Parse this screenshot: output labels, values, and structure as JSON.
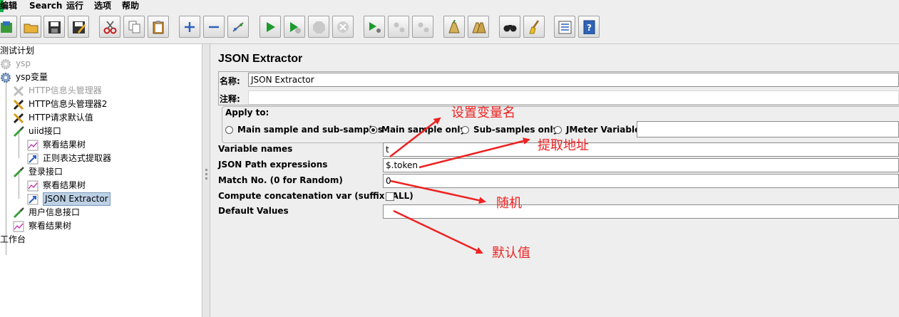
{
  "menu": [
    "编辑",
    "Search",
    "运行",
    "选项",
    "帮助"
  ],
  "toolbar": {
    "icons": [
      "open-templates-icon",
      "open-folder-icon",
      "save-icon",
      "save-as-icon",
      "cut-icon",
      "copy-icon",
      "paste-icon",
      "expand-icon",
      "collapse-icon",
      "toggle-icon",
      "start-icon",
      "start-no-pause-icon",
      "stop-icon",
      "shutdown-icon",
      "remote-start-icon",
      "remote-stop-icon",
      "remote-shutdown-icon",
      "clear-icon",
      "clear-all-icon",
      "search-icon",
      "reset-search-icon",
      "function-helper-icon",
      "help-icon"
    ]
  },
  "tree": [
    {
      "label": "测试计划",
      "icon": "none"
    },
    {
      "label": "ysp",
      "icon": "gear-icon",
      "disabled": true
    },
    {
      "label": "ysp变量",
      "icon": "gear-icon"
    },
    {
      "label": "HTTP信息头管理器",
      "icon": "wrench-icon",
      "disabled": true
    },
    {
      "label": "HTTP信息头管理器2",
      "icon": "wrench-icon"
    },
    {
      "label": "HTTP请求默认值",
      "icon": "wrench-icon"
    },
    {
      "label": "uiid接口",
      "icon": "pipette-icon"
    },
    {
      "label": "察看结果树",
      "icon": "graph-icon"
    },
    {
      "label": "正则表达式提取器",
      "icon": "extractor-icon"
    },
    {
      "label": "登录接口",
      "icon": "pipette-icon"
    },
    {
      "label": "察看结果树",
      "icon": "graph-icon"
    },
    {
      "label": "JSON Extractor",
      "icon": "extractor-icon",
      "selected": true
    },
    {
      "label": "用户信息接口",
      "icon": "pipette-icon"
    },
    {
      "label": "察看结果树",
      "icon": "graph-icon"
    },
    {
      "label": "工作台",
      "icon": "none"
    }
  ],
  "panel": {
    "title": "JSON Extractor",
    "name_label": "名称:",
    "name_value": "JSON Extractor",
    "comment_label": "注释:",
    "comment_value": "",
    "apply_to_label": "Apply to:",
    "apply_options": [
      {
        "label": "Main sample and sub-samples",
        "selected": false
      },
      {
        "label": "Main sample only",
        "selected": true
      },
      {
        "label": "Sub-samples only",
        "selected": false
      },
      {
        "label": "JMeter Variable",
        "selected": false
      }
    ],
    "jmeter_variable_value": "",
    "variable_names_label": "Variable names",
    "variable_names_value": "t",
    "json_path_label": "JSON Path expressions",
    "json_path_value": "$.token",
    "match_no_label": "Match No. (0 for Random)",
    "match_no_value": "0",
    "concat_label": "Compute concatenation var (suffix _ALL)",
    "concat_checked": false,
    "default_values_label": "Default Values",
    "default_values_value": ""
  },
  "annotations": {
    "color": "#ee2222",
    "set_var_name": "设置变量名",
    "extract_address": "提取地址",
    "random": "随机",
    "default_value": "默认值"
  }
}
